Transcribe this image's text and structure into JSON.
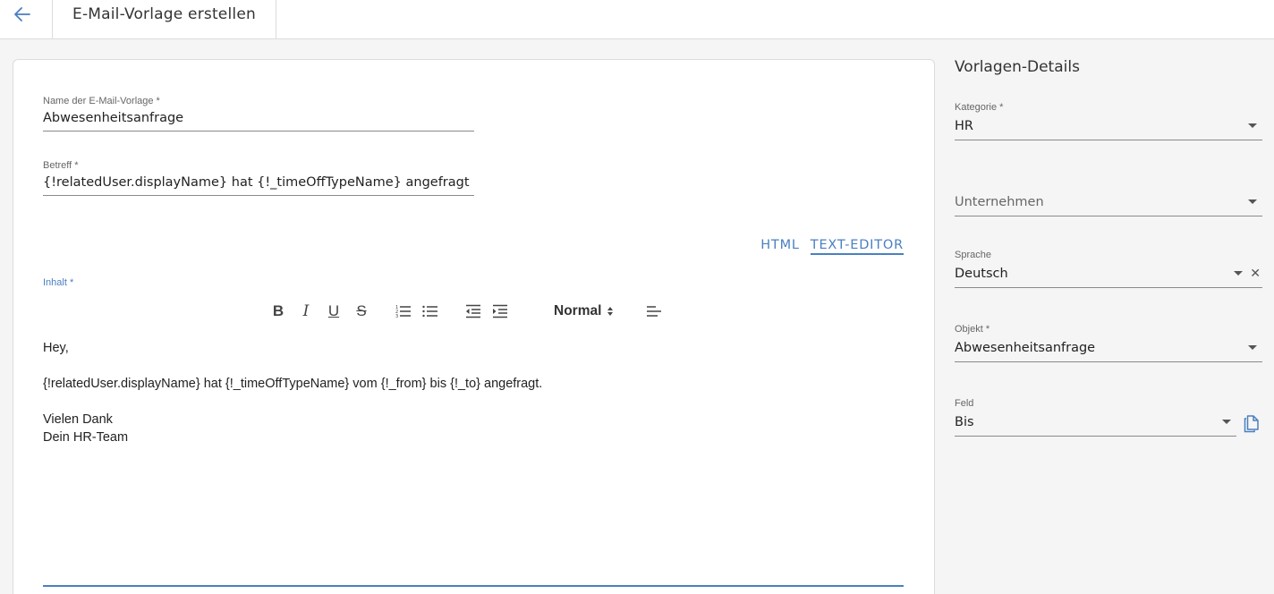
{
  "header": {
    "back_icon": "arrow-left-icon",
    "title": "E-Mail-Vorlage erstellen"
  },
  "form": {
    "name": {
      "label": "Name der E-Mail-Vorlage *",
      "value": "Abwesenheitsanfrage"
    },
    "subject": {
      "label": "Betreff *",
      "value": "{!relatedUser.displayName} hat {!_timeOffTypeName} angefragt"
    },
    "modes": {
      "html": "HTML",
      "text_editor": "TEXT-EDITOR",
      "active": "TEXT-EDITOR"
    },
    "content_label": "Inhalt *",
    "toolbar": {
      "bold": "B",
      "italic": "I",
      "underline": "U",
      "strike": "S",
      "format": "Normal",
      "icons": [
        "ordered-list-icon",
        "bullet-list-icon",
        "outdent-icon",
        "indent-icon",
        "align-icon"
      ]
    },
    "body": {
      "line1": "Hey,",
      "line2": "",
      "line3": "{!relatedUser.displayName} hat {!_timeOffTypeName} vom {!_from} bis {!_to} angefragt.",
      "line4": "",
      "line5": "Vielen Dank",
      "line6": "Dein HR-Team"
    }
  },
  "details": {
    "title": "Vorlagen-Details",
    "category": {
      "label": "Kategorie *",
      "value": "HR"
    },
    "company": {
      "placeholder": "Unternehmen"
    },
    "language": {
      "label": "Sprache",
      "value": "Deutsch"
    },
    "object": {
      "label": "Objekt *",
      "value": "Abwesenheitsanfrage"
    },
    "field": {
      "label": "Feld",
      "value": "Bis"
    },
    "copy_icon": "copy-icon"
  },
  "colors": {
    "accent": "#4a7fc1",
    "background": "#f5f5f5",
    "card": "#ffffff"
  }
}
